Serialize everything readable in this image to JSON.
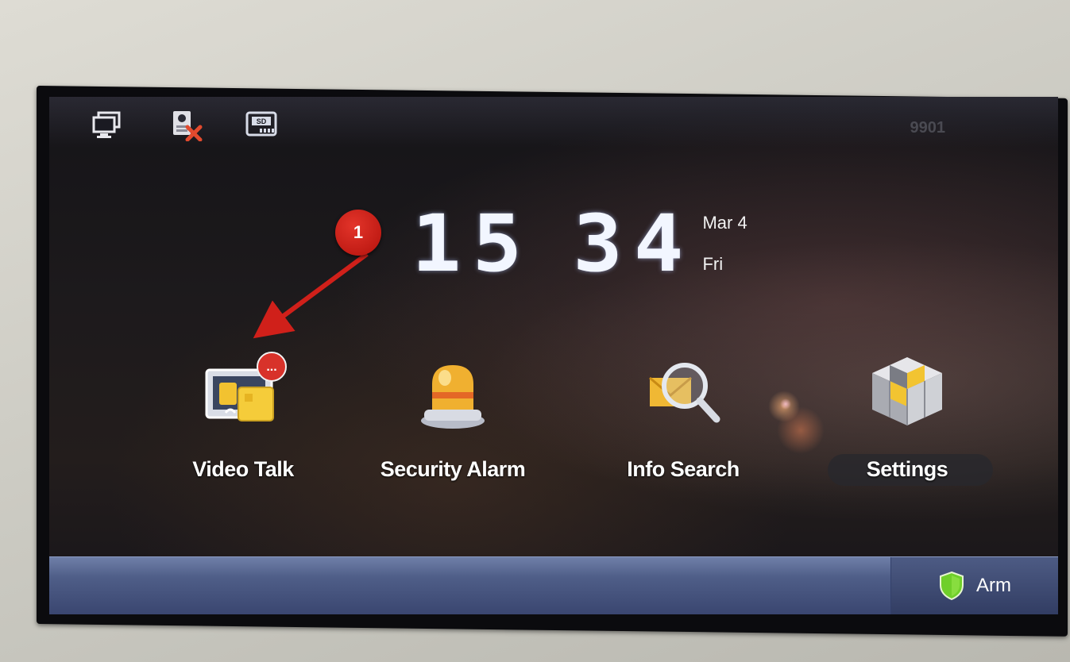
{
  "status_bar": {
    "icons": [
      "monitor-icon",
      "camera-offline-icon",
      "sd-card-icon"
    ],
    "device_id": "9901"
  },
  "clock": {
    "hours": "15",
    "minutes": "34",
    "date": "Mar 4",
    "weekday": "Fri"
  },
  "annotation": {
    "badge": "1",
    "color": "#d0201a"
  },
  "apps": [
    {
      "label": "Video Talk",
      "icon": "video-talk-icon",
      "badge": "..."
    },
    {
      "label": "Security Alarm",
      "icon": "alarm-light-icon"
    },
    {
      "label": "Info Search",
      "icon": "info-search-icon"
    },
    {
      "label": "Settings",
      "icon": "settings-cube-icon"
    }
  ],
  "taskbar": {
    "arm_label": "Arm",
    "arm_icon": "shield-icon",
    "shield_color": "#6fcf2a"
  }
}
